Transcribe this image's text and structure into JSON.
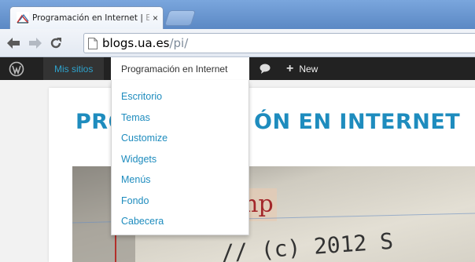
{
  "browser": {
    "tab": {
      "title": "Programación en Internet | ",
      "title_faded": "E",
      "close_label": "×",
      "favicon": "wordpress-site-favicon"
    },
    "nav": {
      "back_icon": "back-arrow-icon",
      "forward_icon": "forward-arrow-icon",
      "reload_icon": "reload-icon"
    },
    "address": {
      "host": "blogs.ua.es",
      "path": "/pi/"
    }
  },
  "adminbar": {
    "logo": "wordpress-logo-icon",
    "my_sites": "Mis sitios",
    "site_name": "Programación en Internet",
    "comments_icon": "comment-bubble-icon",
    "new_label": "New",
    "new_plus": "+"
  },
  "dropdown": {
    "items": [
      {
        "label": "Escritorio"
      },
      {
        "label": "Temas"
      },
      {
        "label": "Customize"
      },
      {
        "label": "Widgets"
      },
      {
        "label": "Menús"
      },
      {
        "label": "Fondo"
      },
      {
        "label": "Cabecera"
      }
    ]
  },
  "page": {
    "title_left": "PRO",
    "title_right": "ÓN EN INTERNET",
    "header_image_text": {
      "word": "mp",
      "comment": "// (c) 2012 S"
    }
  },
  "colors": {
    "link": "#1e8cbe",
    "adminbar": "#222222",
    "tab_bar": "#6a96d0"
  }
}
